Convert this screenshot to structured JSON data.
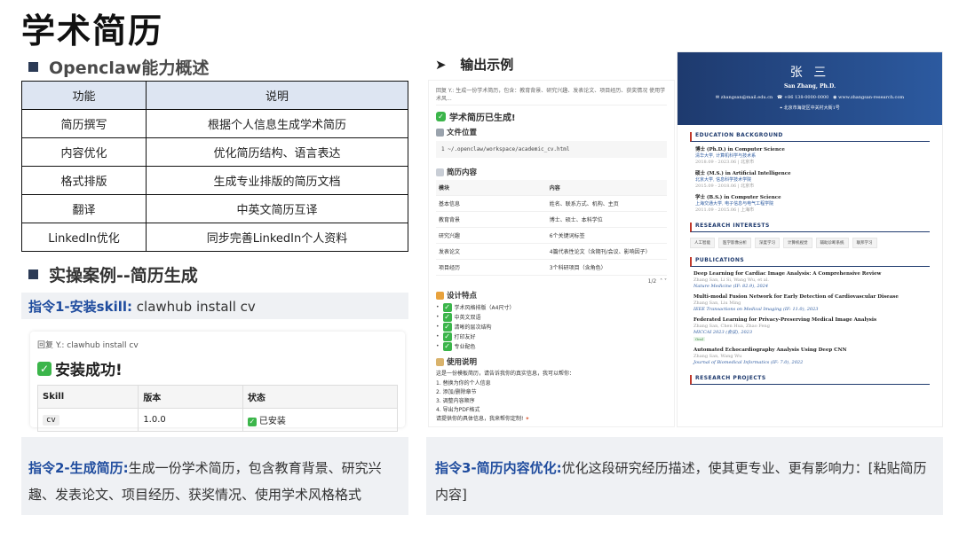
{
  "slide": {
    "title": "学术简历",
    "section1_title": "Openclaw能力概述",
    "section2_title": "实操案例--简历生成",
    "output_label": "输出示例"
  },
  "capabilities": {
    "headers": [
      "功能",
      "说明"
    ],
    "rows": [
      [
        "简历撰写",
        "根据个人信息生成学术简历"
      ],
      [
        "内容优化",
        "优化简历结构、语言表达"
      ],
      [
        "格式排版",
        "生成专业排版的简历文档"
      ],
      [
        "翻译",
        "中英文简历互译"
      ],
      [
        "LinkedIn优化",
        "同步完善LinkedIn个人资料"
      ]
    ]
  },
  "cmd1": {
    "label": "指令1-安装skill:",
    "text": "clawhub install cv"
  },
  "cmd2": {
    "label": "指令2-生成简历:",
    "text": "生成一份学术简历，包含教育背景、研究兴趣、发表论文、项目经历、获奖情况、使用学术风格格式"
  },
  "cmd3": {
    "label": "指令3-简历内容优化:",
    "text": "优化这段研究经历描述，使其更专业、更有影响力：[粘贴简历内容]"
  },
  "install_card": {
    "reply": "回复 Y.: clawhub install cv",
    "status": "安装成功!",
    "headers": [
      "Skill",
      "版本",
      "状态"
    ],
    "skill": "cv",
    "version": "1.0.0",
    "state": "已安装"
  },
  "chat_panel": {
    "reply": "回复 Y.: 生成一份学术简历，包含：教育背景、研究兴趣、发表论文、项目经历、获奖情况 使用学术风...",
    "done": "学术简历已生成!",
    "file_label": "文件位置",
    "path": "1  ~/.openclaw/workspace/academic_cv.html",
    "content_label": "简历内容",
    "table_headers": [
      "模块",
      "内容"
    ],
    "table_rows": [
      [
        "基本信息",
        "姓名、联系方式、机构、主页"
      ],
      [
        "教育背景",
        "博士、硕士、本科学位"
      ],
      [
        "研究兴趣",
        "6个关键词标签"
      ],
      [
        "发表论文",
        "4篇代表性论文（含期刊/会议、影响因子）"
      ],
      [
        "项目经历",
        "3个科研项目（含角色）"
      ]
    ],
    "pager": "1/2",
    "design_label": "设计特点",
    "design_items": [
      "学术风格排版（A4尺寸）",
      "中英文双语",
      "清晰的层次结构",
      "打印友好",
      "专业配色"
    ],
    "usage_label": "使用说明",
    "usage_intro": "这是一份模板简历，请告诉我你的真实信息，我可以帮你：",
    "usage_items": [
      "1. 替换为你的个人信息",
      "2. 添加/删除章节",
      "3. 调整内容顺序",
      "4. 导出为PDF格式"
    ],
    "usage_outro": "请提供你的具体信息，我来帮你定制!"
  },
  "cv": {
    "name": "张 三",
    "name_en": "San Zhang, Ph.D.",
    "email": "zhangsan@mail.edu.cn",
    "phone": "+86 138-0000-0000",
    "web": "www.zhangsan-research.com",
    "address": "北京市海淀区中关村大街1号",
    "edu_title": "EDUCATION BACKGROUND",
    "edu": [
      {
        "degree": "博士 (Ph.D.) in Computer Science",
        "school": "清华大学, 计算机科学与技术系",
        "date": "2018.09 - 2023.06 | 北京市"
      },
      {
        "degree": "硕士 (M.S.) in Artificial Intelligence",
        "school": "北京大学, 信息科学技术学院",
        "date": "2015.09 - 2018.06 | 北京市"
      },
      {
        "degree": "学士 (B.S.) in Computer Science",
        "school": "上海交通大学, 电子信息与电气工程学院",
        "date": "2011.09 - 2015.06 | 上海市"
      }
    ],
    "ri_title": "RESEARCH INTERESTS",
    "interests": [
      "人工智能",
      "医学影像分析",
      "深度学习",
      "计算机视觉",
      "辅助诊断系统",
      "联邦学习"
    ],
    "pub_title": "PUBLICATIONS",
    "pubs": [
      {
        "t": "Deep Learning for Cardiac Image Analysis: A Comprehensive Review",
        "a": "Zhang San, Li Si, Wang Wu, et al.",
        "j": "Nature Medicine (IF: 82.9), 2024"
      },
      {
        "t": "Multi-modal Fusion Network for Early Detection of Cardiovascular Disease",
        "a": "Zhang San, Liu Ming",
        "j": "IEEE Transactions on Medical Imaging (IF: 11.0), 2023"
      },
      {
        "t": "Federated Learning for Privacy-Preserving Medical Image Analysis",
        "a": "Zhang San, Chen Hua, Zhao Feng",
        "j": "MICCAI 2023 (会议), 2023",
        "badge": "Oral"
      },
      {
        "t": "Automated Echocardiography Analysis Using Deep CNN",
        "a": "Zhang San, Wang Wu",
        "j": "Journal of Biomedical Informatics (IF: 7.0), 2022"
      }
    ],
    "proj_title": "RESEARCH PROJECTS"
  }
}
